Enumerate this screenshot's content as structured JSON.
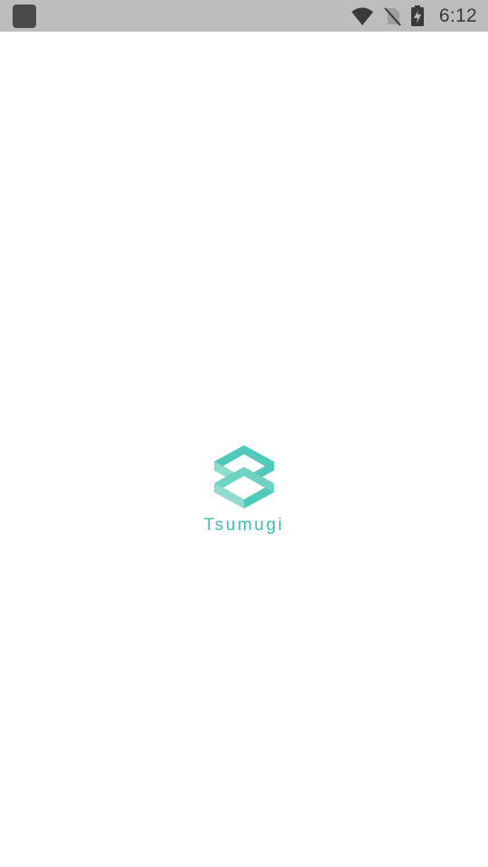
{
  "status_bar": {
    "time": "6:12",
    "icons": [
      "app-notification-icon",
      "wifi-icon",
      "no-sim-icon",
      "battery-charging-icon"
    ]
  },
  "splash": {
    "app_name": "Tsumugi",
    "logo_icon": "tsumugi-logo-icon",
    "colors": {
      "brand_primary": "#3ebfb0",
      "brand_light": "#8fdccf",
      "background": "#ffffff",
      "status_bar": "#bdbdbd"
    }
  }
}
